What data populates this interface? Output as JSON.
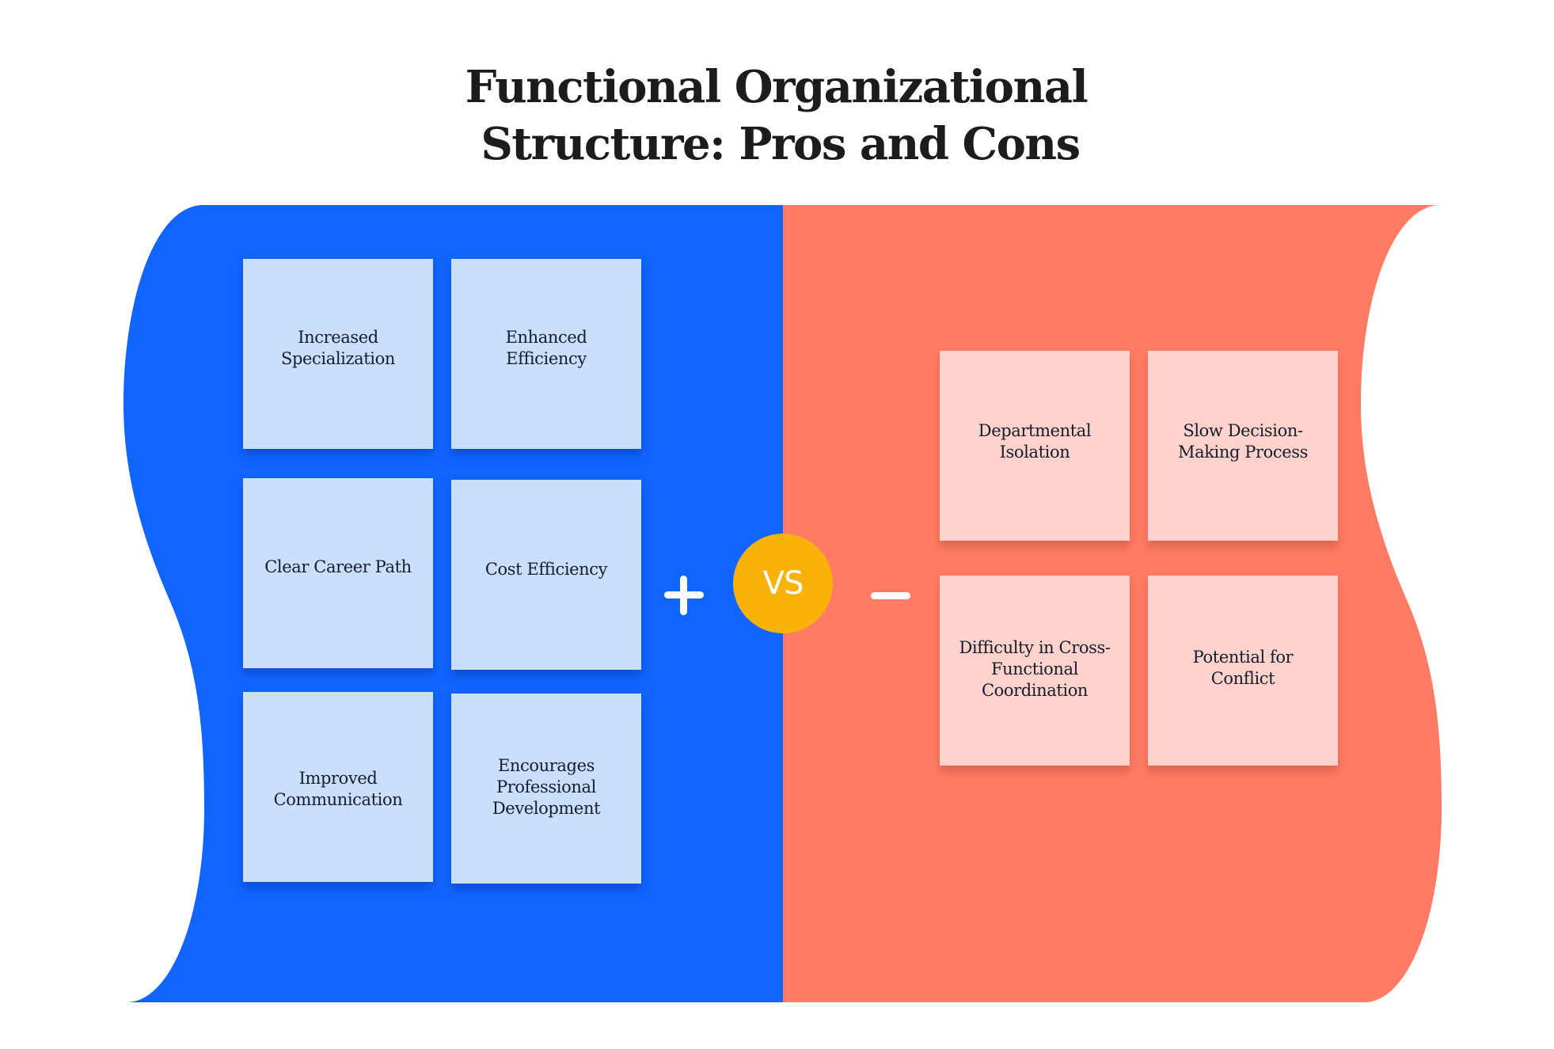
{
  "title": {
    "line1": "Functional Organizational",
    "line2": "Structure: Pros and Cons"
  },
  "colors": {
    "pros_panel": "#1065ff",
    "cons_panel": "#ff7b65",
    "pros_card": "#cadffd",
    "cons_card": "#ffd2cb",
    "vs_badge": "#f9b207",
    "text": "#151c2e"
  },
  "pros": {
    "symbol": "plus-icon",
    "items": [
      {
        "label": "Increased Specialization"
      },
      {
        "label": "Enhanced Efficiency"
      },
      {
        "label": "Clear Career Path"
      },
      {
        "label": "Cost Efficiency"
      },
      {
        "label": "Improved Communication"
      },
      {
        "label": "Encourages Professional Development"
      }
    ]
  },
  "cons": {
    "symbol": "minus-icon",
    "items": [
      {
        "label": "Departmental Isolation"
      },
      {
        "label": "Slow Decision-Making Process"
      },
      {
        "label": "Difficulty in Cross-Functional Coordination"
      },
      {
        "label": "Potential for Conflict"
      }
    ]
  },
  "vs_badge": {
    "label": "VS"
  }
}
